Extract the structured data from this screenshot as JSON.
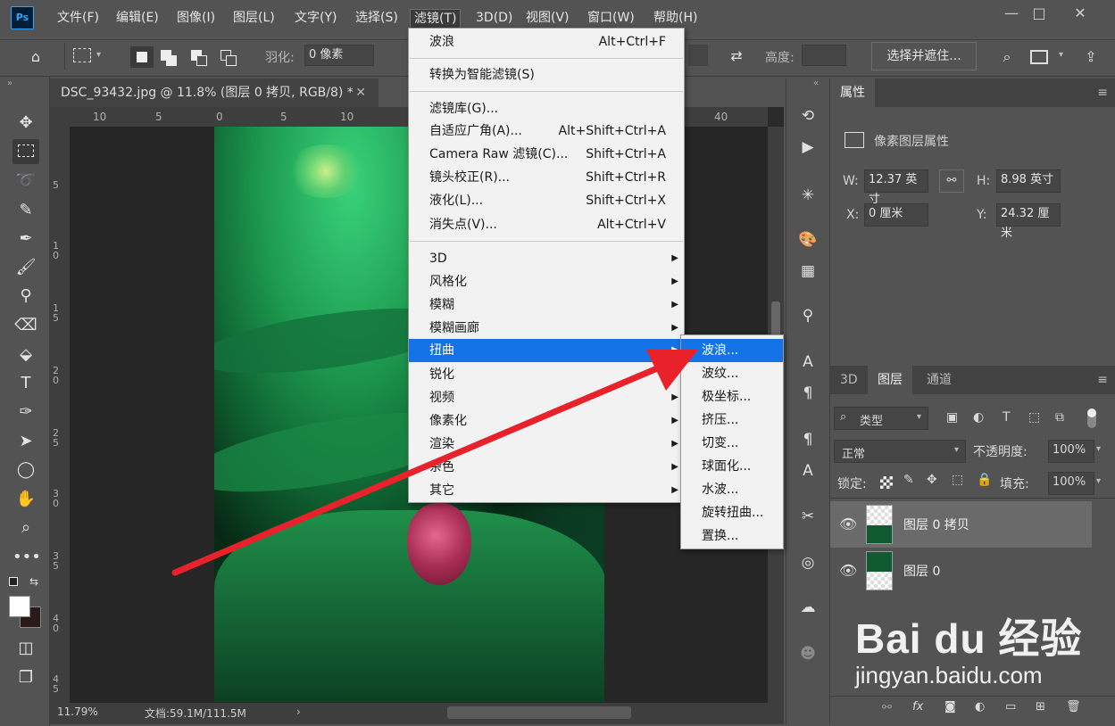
{
  "app": {
    "logo": "Ps"
  },
  "menubar": {
    "items": [
      "文件(F)",
      "编辑(E)",
      "图像(I)",
      "图层(L)",
      "文字(Y)",
      "选择(S)",
      "滤镜(T)",
      "3D(D)",
      "视图(V)",
      "窗口(W)",
      "帮助(H)"
    ],
    "active": "滤镜(T)",
    "window_buttons": {
      "minimize": "—",
      "restore": "□",
      "close": "✕"
    }
  },
  "options": {
    "feather_label": "羽化:",
    "feather_value": "0 像素",
    "height_label": "高度:",
    "select_mask_button": "选择并遮住..."
  },
  "document": {
    "tab_title": "DSC_93432.jpg @ 11.8% (图层 0 拷贝, RGB/8) *",
    "ruler_top": [
      "10",
      "5",
      "0",
      "5",
      "10",
      "40"
    ],
    "ruler_left": [
      "5",
      "1 0",
      "1 5",
      "2 0",
      "2 5",
      "3 0",
      "3 5",
      "4 0",
      "4 5"
    ],
    "zoom": "11.79%",
    "doc_info": "文档:59.1M/111.5M"
  },
  "filter_menu": {
    "items": [
      {
        "label": "波浪",
        "shortcut": "Alt+Ctrl+F"
      },
      {
        "label": "转换为智能滤镜(S)",
        "shortcut": ""
      },
      {
        "label": "滤镜库(G)...",
        "shortcut": ""
      },
      {
        "label": "自适应广角(A)...",
        "shortcut": "Alt+Shift+Ctrl+A"
      },
      {
        "label": "Camera Raw 滤镜(C)...",
        "shortcut": "Shift+Ctrl+A"
      },
      {
        "label": "镜头校正(R)...",
        "shortcut": "Shift+Ctrl+R"
      },
      {
        "label": "液化(L)...",
        "shortcut": "Shift+Ctrl+X"
      },
      {
        "label": "消失点(V)...",
        "shortcut": "Alt+Ctrl+V"
      },
      {
        "label": "3D",
        "shortcut": ""
      },
      {
        "label": "风格化",
        "shortcut": ""
      },
      {
        "label": "模糊",
        "shortcut": ""
      },
      {
        "label": "模糊画廊",
        "shortcut": ""
      },
      {
        "label": "扭曲",
        "shortcut": ""
      },
      {
        "label": "锐化",
        "shortcut": ""
      },
      {
        "label": "视频",
        "shortcut": ""
      },
      {
        "label": "像素化",
        "shortcut": ""
      },
      {
        "label": "渲染",
        "shortcut": ""
      },
      {
        "label": "杂色",
        "shortcut": ""
      },
      {
        "label": "其它",
        "shortcut": ""
      }
    ],
    "submenu_arrow": "▶",
    "highlighted": "扭曲"
  },
  "distort_submenu": {
    "items": [
      "波浪...",
      "波纹...",
      "极坐标...",
      "挤压...",
      "切变...",
      "球面化...",
      "水波...",
      "旋转扭曲...",
      "置换..."
    ],
    "highlighted": "波浪..."
  },
  "properties": {
    "tab": "属性",
    "header": "像素图层属性",
    "w_label": "W:",
    "w_value": "12.37 英寸",
    "h_label": "H:",
    "h_value": "8.98 英寸",
    "x_label": "X:",
    "x_value": "0 厘米",
    "y_label": "Y:",
    "y_value": "24.32 厘米"
  },
  "layers_panel": {
    "tabs": [
      "3D",
      "图层",
      "通道"
    ],
    "active_tab": "图层",
    "filter_kind": "类型",
    "blend_mode": "正常",
    "opacity_label": "不透明度:",
    "opacity_value": "100%",
    "lock_label": "锁定:",
    "fill_label": "填充:",
    "fill_value": "100%",
    "layers": [
      {
        "name": "图层 0 拷贝",
        "selected": true
      },
      {
        "name": "图层 0",
        "selected": false
      }
    ],
    "footer_fx": "fx"
  },
  "watermark": {
    "brand": "Bai du 经验",
    "url": "jingyan.baidu.com"
  },
  "colors": {
    "highlight": "#1473e6",
    "arrow": "#e8212a",
    "panel_bg": "#535353",
    "dark_bg": "#262626"
  }
}
